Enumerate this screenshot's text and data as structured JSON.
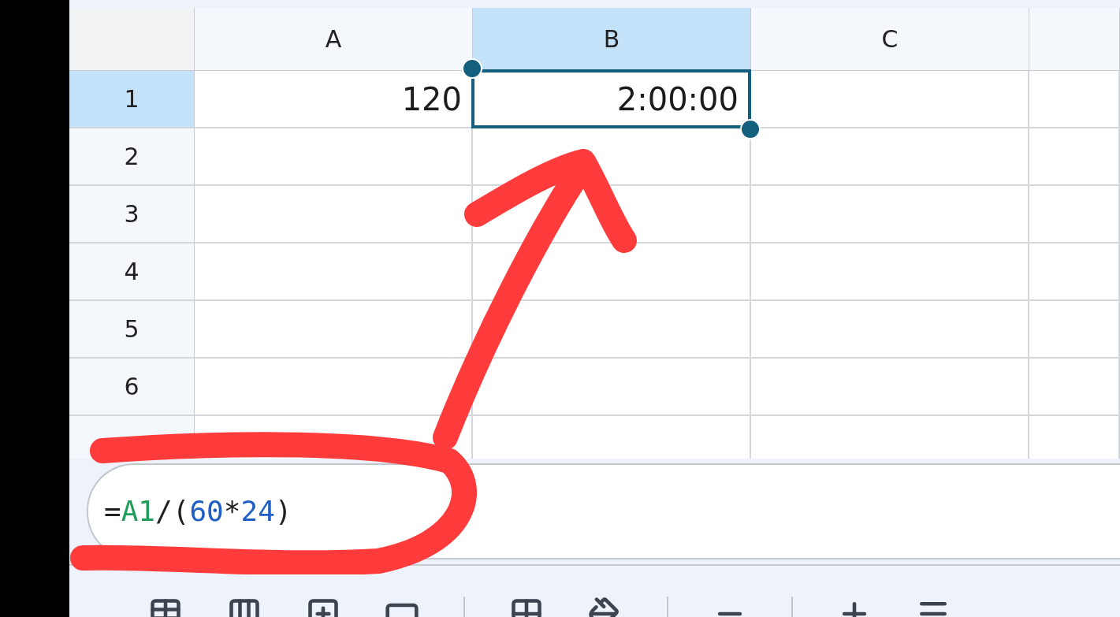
{
  "columns": [
    {
      "label": "A",
      "selected": false
    },
    {
      "label": "B",
      "selected": true
    },
    {
      "label": "C",
      "selected": false
    },
    {
      "selected": false
    }
  ],
  "rows": [
    {
      "label": "1",
      "selected": true,
      "cells": [
        {
          "value": "120",
          "selected": false
        },
        {
          "value": "2:00:00",
          "selected": true
        }
      ]
    },
    {
      "label": "2",
      "selected": false,
      "cells": []
    },
    {
      "label": "3",
      "selected": false,
      "cells": []
    },
    {
      "label": "4",
      "selected": false,
      "cells": []
    },
    {
      "label": "5",
      "selected": false,
      "cells": []
    },
    {
      "label": "6",
      "selected": false,
      "cells": []
    },
    {
      "selected": false,
      "cells": []
    }
  ],
  "formula_bar": {
    "tokens": [
      {
        "text": "=",
        "kind": "operator"
      },
      {
        "text": "A1",
        "kind": "reference"
      },
      {
        "text": "/(",
        "kind": "operator"
      },
      {
        "text": "60",
        "kind": "number"
      },
      {
        "text": "*",
        "kind": "operator"
      },
      {
        "text": "24",
        "kind": "number"
      },
      {
        "text": ")",
        "kind": "operator"
      }
    ]
  }
}
